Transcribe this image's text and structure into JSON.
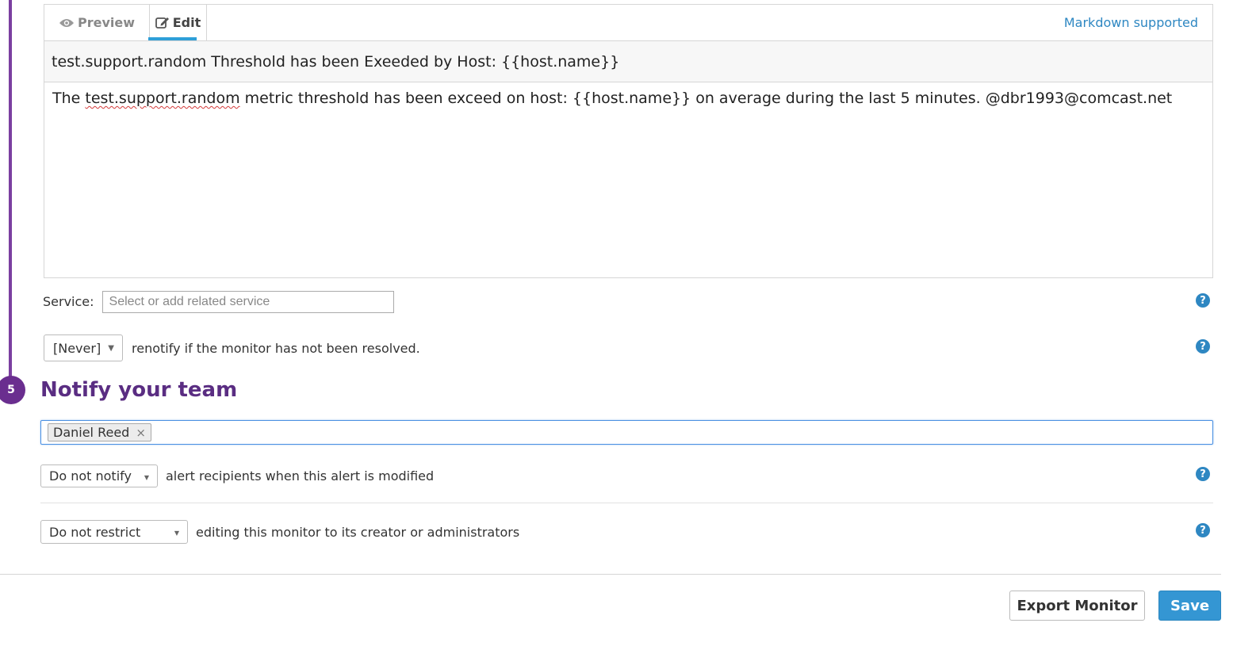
{
  "step": {
    "number": "5"
  },
  "editor": {
    "tabs": {
      "preview": "Preview",
      "edit": "Edit"
    },
    "markdown_link": "Markdown supported",
    "subject": "test.support.random Threshold has been Exeeded by Host: {{host.name}}",
    "body": {
      "prefix": "The ",
      "misspelled": "test.support.random",
      "rest": " metric threshold has been exceed on host: {{host.name}} on average during the last 5 minutes. @dbr1993@comcast.net"
    }
  },
  "service": {
    "label": "Service:",
    "placeholder": "Select or add related service"
  },
  "renotify": {
    "selected": "[Never]",
    "text": "renotify if the monitor has not been resolved."
  },
  "notify_team": {
    "heading": "Notify your team",
    "recipients": [
      "Daniel Reed"
    ],
    "remove_symbol": "×"
  },
  "modify_notify": {
    "selected": "Do not notify",
    "text": "alert recipients when this alert is modified"
  },
  "restrict": {
    "selected": "Do not restrict",
    "text": "editing this monitor to its creator or administrators"
  },
  "help_symbol": "?",
  "buttons": {
    "export": "Export Monitor",
    "save": "Save"
  },
  "colors": {
    "accent_purple": "#6a2e8f",
    "link_blue": "#2e87c2",
    "save_blue": "#3496d3",
    "focus_blue": "#4a90e2"
  }
}
